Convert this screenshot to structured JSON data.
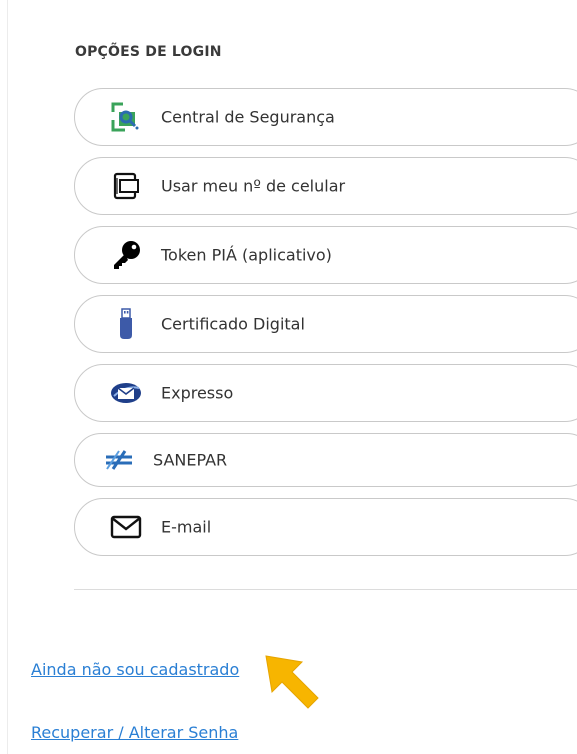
{
  "login": {
    "section_title": "OPÇÕES DE LOGIN",
    "options": [
      {
        "label": "Central de Segurança",
        "icon": "central-seguranca-icon"
      },
      {
        "label": "Usar meu nº de celular",
        "icon": "mobile-phone-icon"
      },
      {
        "label": "Token PIÁ (aplicativo)",
        "icon": "key-icon"
      },
      {
        "label": "Certificado Digital",
        "icon": "usb-token-icon"
      },
      {
        "label": "Expresso",
        "icon": "expresso-mail-icon"
      },
      {
        "label": "SANEPAR",
        "icon": "sanepar-icon"
      },
      {
        "label": "E-mail",
        "icon": "envelope-icon"
      }
    ]
  },
  "links": {
    "register": "Ainda não sou cadastrado",
    "recover": "Recuperar / Alterar Senha"
  },
  "colors": {
    "link": "#2a7fd4",
    "arrow": "#f7b500",
    "central_green": "#3aa35a",
    "central_blue": "#2b6cb0",
    "usb_blue": "#3d5aa8",
    "sanepar_blue": "#2a6db8"
  }
}
